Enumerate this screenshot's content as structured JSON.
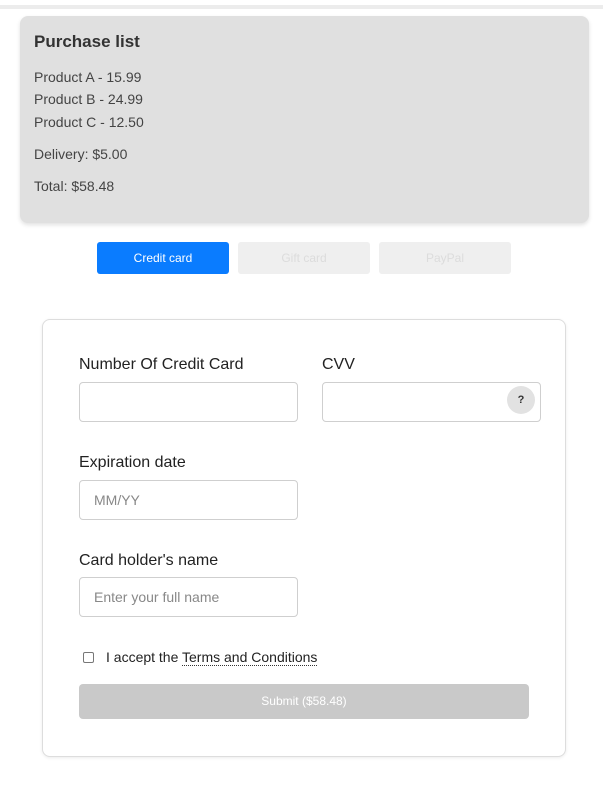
{
  "summary": {
    "title": "Purchase list",
    "items": [
      "Product A - 15.99",
      "Product B - 24.99",
      "Product C - 12.50"
    ],
    "delivery": "Delivery: $5.00",
    "total": "Total: $58.48"
  },
  "payment_tabs": [
    {
      "label": "Credit card",
      "active": true
    },
    {
      "label": "Gift card",
      "active": false
    },
    {
      "label": "PayPal",
      "active": false
    }
  ],
  "form": {
    "card_number_label": "Number Of Credit Card",
    "card_number_value": "",
    "cvv_label": "CVV",
    "cvv_value": "",
    "cvv_help": "?",
    "expiration_label": "Expiration date",
    "expiration_placeholder": "MM/YY",
    "holder_label": "Card holder's name",
    "holder_placeholder": "Enter your full name",
    "terms_prefix": "I accept the ",
    "terms_link": "Terms and Conditions",
    "terms_checked": false,
    "submit_label": "Submit ($58.48)"
  },
  "colors": {
    "accent": "#0a7cff",
    "summary_bg": "#e0e0e0",
    "disabled": "#c9c9c9"
  }
}
